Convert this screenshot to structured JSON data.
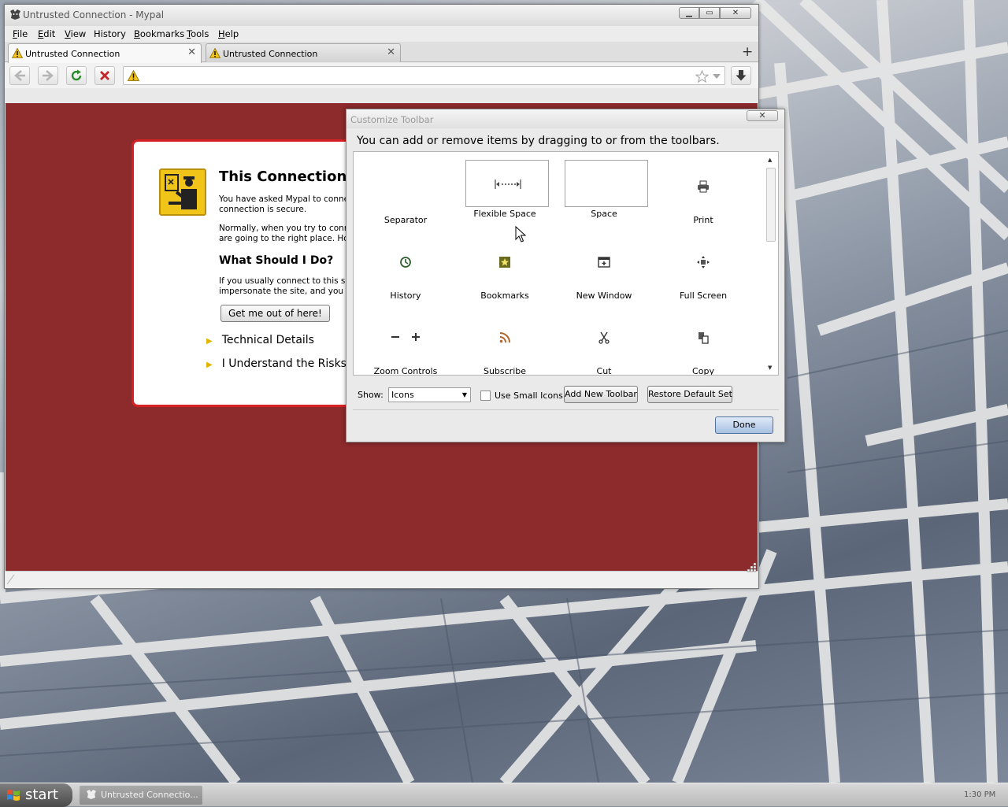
{
  "browser": {
    "window_title": "Untrusted Connection - Mypal",
    "window_controls": {
      "minimize": "▁",
      "maximize": "▭",
      "close": "✕"
    },
    "menu": [
      {
        "accel": "F",
        "rest": "ile"
      },
      {
        "accel": "E",
        "rest": "dit"
      },
      {
        "accel": "V",
        "rest": "iew"
      },
      {
        "accel": "",
        "rest": "History"
      },
      {
        "accel": "B",
        "rest": "ookmarks"
      },
      {
        "accel": "T",
        "rest": "ools"
      },
      {
        "accel": "H",
        "rest": "elp"
      }
    ],
    "tabs": [
      {
        "label": "Untrusted Connection",
        "close": "✕"
      },
      {
        "label": "Untrusted Connection",
        "close": "✕"
      }
    ],
    "new_tab": "+",
    "nav_icons": [
      "back-icon",
      "forward-icon",
      "reload-icon",
      "stop-icon",
      "warning-icon",
      "bookmark-star-icon",
      "downloads-icon"
    ]
  },
  "error_page": {
    "title": "This Connection is",
    "p1_line1": "You have asked Mypal to connect",
    "p1_line2": "connection is secure.",
    "p2_line1": "Normally, when you try to connec",
    "p2_line2": "are going to the right place. Howe",
    "heading": "What Should I Do?",
    "p3_line1": "If you usually connect to this site",
    "p3_line2": "impersonate the site, and you sho",
    "get_out_button": "Get me out of here!",
    "technical_details": "Technical Details",
    "understand_risks": "I Understand the Risks",
    "expander_arrow": "▶",
    "page_background": "#8c2a2c",
    "border_color": "#d72124"
  },
  "dialog": {
    "title": "Customize Toolbar",
    "close": "✕",
    "instructions": "You can add or remove items by dragging to or from the toolbars.",
    "palette": [
      {
        "label": "Separator",
        "icon": "separator-icon"
      },
      {
        "label": "Flexible Space",
        "icon": "flexible-space-icon"
      },
      {
        "label": "Space",
        "icon": "space-icon"
      },
      {
        "label": "Print",
        "icon": "print-icon"
      },
      {
        "label": "History",
        "icon": "history-icon"
      },
      {
        "label": "Bookmarks",
        "icon": "bookmarks-icon"
      },
      {
        "label": "New Window",
        "icon": "new-window-icon"
      },
      {
        "label": "Full Screen",
        "icon": "full-screen-icon"
      },
      {
        "label": "Zoom Controls",
        "icon": "zoom-controls-icon"
      },
      {
        "label": "Subscribe",
        "icon": "subscribe-icon"
      },
      {
        "label": "Cut",
        "icon": "cut-icon"
      },
      {
        "label": "Copy",
        "icon": "copy-icon"
      }
    ],
    "show_label": "Show:",
    "show_value": "Icons",
    "small_icons_label": "Use Small Icons",
    "small_icons_checked": false,
    "add_toolbar_button": "Add New Toolbar",
    "restore_button": "Restore Default Set",
    "done_button": "Done"
  },
  "taskbar": {
    "start_label": "start",
    "task_label": "Untrusted Connectio...",
    "clock": "1:30 PM"
  }
}
